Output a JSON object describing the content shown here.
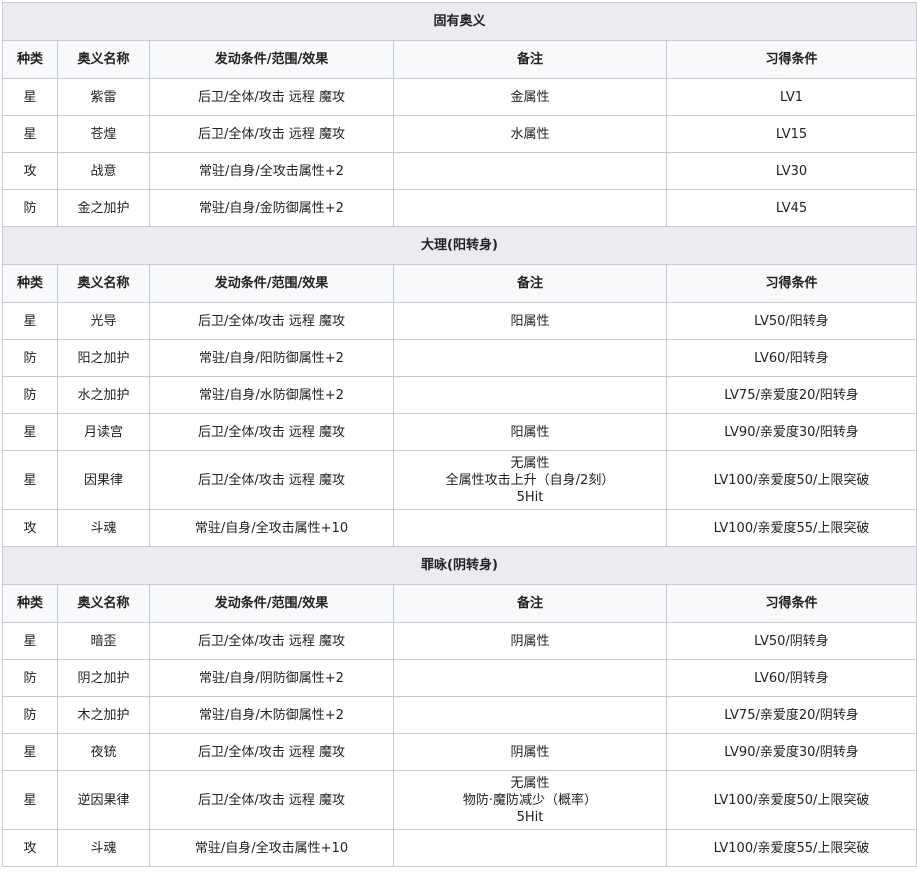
{
  "headers": [
    "种类",
    "奥义名称",
    "发动条件/范围/效果",
    "备注",
    "习得条件"
  ],
  "sections": [
    {
      "title": "固有奥义",
      "rows": [
        {
          "type": "星",
          "name": "紫雷",
          "effect": "后卫/全体/攻击 远程 魔攻",
          "note": [
            "金属性"
          ],
          "req": "LV1"
        },
        {
          "type": "星",
          "name": "苍煌",
          "effect": "后卫/全体/攻击 远程 魔攻",
          "note": [
            "水属性"
          ],
          "req": "LV15"
        },
        {
          "type": "攻",
          "name": "战意",
          "effect": "常驻/自身/全攻击属性+2",
          "note": [],
          "req": "LV30"
        },
        {
          "type": "防",
          "name": "金之加护",
          "effect": "常驻/自身/金防御属性+2",
          "note": [],
          "req": "LV45"
        }
      ]
    },
    {
      "title": "大理(阳转身)",
      "rows": [
        {
          "type": "星",
          "name": "光导",
          "effect": "后卫/全体/攻击 远程 魔攻",
          "note": [
            "阳属性"
          ],
          "req": "LV50/阳转身"
        },
        {
          "type": "防",
          "name": "阳之加护",
          "effect": "常驻/自身/阳防御属性+2",
          "note": [],
          "req": "LV60/阳转身"
        },
        {
          "type": "防",
          "name": "水之加护",
          "effect": "常驻/自身/水防御属性+2",
          "note": [],
          "req": "LV75/亲爱度20/阳转身"
        },
        {
          "type": "星",
          "name": "月读宫",
          "effect": "后卫/全体/攻击 远程 魔攻",
          "note": [
            "阳属性"
          ],
          "req": "LV90/亲爱度30/阳转身"
        },
        {
          "type": "星",
          "name": "因果律",
          "effect": "后卫/全体/攻击 远程 魔攻",
          "note": [
            "无属性",
            "全属性攻击上升（自身/2刻）",
            "5Hit"
          ],
          "req": "LV100/亲爱度50/上限突破"
        },
        {
          "type": "攻",
          "name": "斗魂",
          "effect": "常驻/自身/全攻击属性+10",
          "note": [],
          "req": "LV100/亲爱度55/上限突破"
        }
      ]
    },
    {
      "title": "罪咏(阴转身)",
      "rows": [
        {
          "type": "星",
          "name": "暗歪",
          "effect": "后卫/全体/攻击 远程 魔攻",
          "note": [
            "阴属性"
          ],
          "req": "LV50/阴转身"
        },
        {
          "type": "防",
          "name": "阴之加护",
          "effect": "常驻/自身/阴防御属性+2",
          "note": [],
          "req": "LV60/阴转身"
        },
        {
          "type": "防",
          "name": "木之加护",
          "effect": "常驻/自身/木防御属性+2",
          "note": [],
          "req": "LV75/亲爱度20/阴转身"
        },
        {
          "type": "星",
          "name": "夜铳",
          "effect": "后卫/全体/攻击 远程 魔攻",
          "note": [
            "阴属性"
          ],
          "req": "LV90/亲爱度30/阴转身"
        },
        {
          "type": "星",
          "name": "逆因果律",
          "effect": "后卫/全体/攻击 远程 魔攻",
          "note": [
            "无属性",
            "物防·魔防减少（概率）",
            "5Hit"
          ],
          "req": "LV100/亲爱度50/上限突破"
        },
        {
          "type": "攻",
          "name": "斗魂",
          "effect": "常驻/自身/全攻击属性+10",
          "note": [],
          "req": "LV100/亲爱度55/上限突破"
        }
      ]
    }
  ],
  "colors": {
    "section_bg": "#eaecf0",
    "header_bg": "#f8f9fa",
    "border": "#c8ccd2"
  }
}
